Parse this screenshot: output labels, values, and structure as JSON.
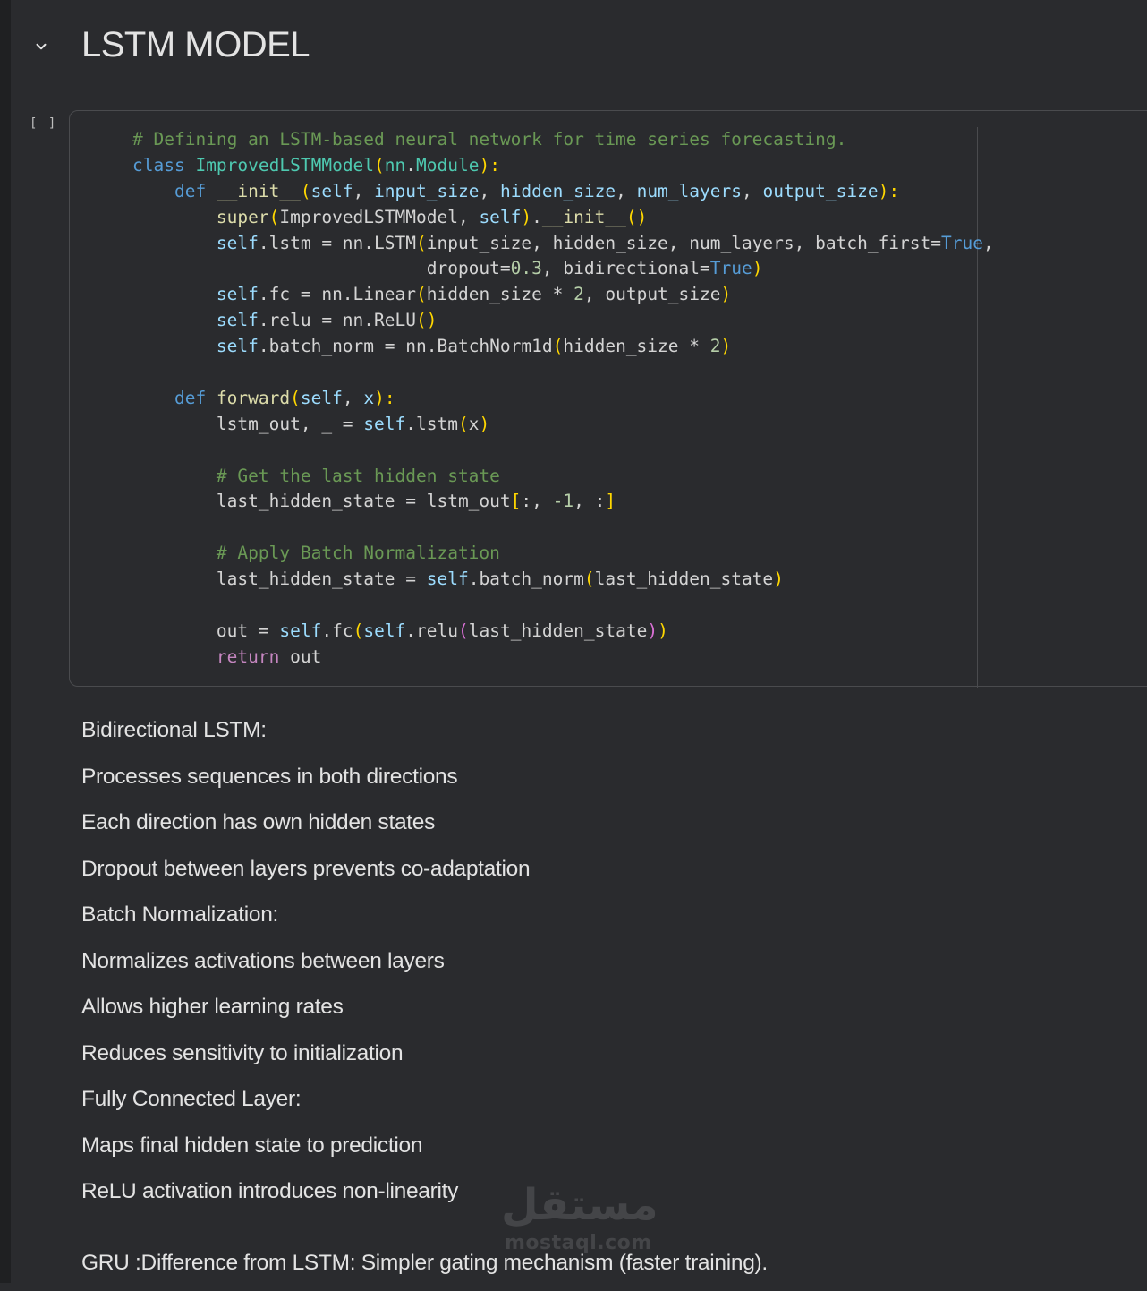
{
  "section": {
    "title": "LSTM MODEL",
    "collapse_icon": "chevron-down-icon"
  },
  "cell": {
    "run_indicator": "[ ]",
    "code_lines": [
      [
        [
          "tk-comment",
          "# Defining an LSTM-based neural network for time series forecasting."
        ]
      ],
      [
        [
          "tk-kw",
          "class "
        ],
        [
          "tk-class",
          "ImprovedLSTMModel"
        ],
        [
          "tk-br1",
          "("
        ],
        [
          "tk-class",
          "nn"
        ],
        [
          "tk-plain",
          "."
        ],
        [
          "tk-class",
          "Module"
        ],
        [
          "tk-br1",
          "):"
        ]
      ],
      [
        [
          "tk-plain",
          "    "
        ],
        [
          "tk-kw",
          "def "
        ],
        [
          "tk-fn",
          "__init__"
        ],
        [
          "tk-br1",
          "("
        ],
        [
          "tk-self",
          "self"
        ],
        [
          "tk-plain",
          ", "
        ],
        [
          "tk-param",
          "input_size"
        ],
        [
          "tk-plain",
          ", "
        ],
        [
          "tk-param",
          "hidden_size"
        ],
        [
          "tk-plain",
          ", "
        ],
        [
          "tk-param",
          "num_layers"
        ],
        [
          "tk-plain",
          ", "
        ],
        [
          "tk-param",
          "output_size"
        ],
        [
          "tk-br1",
          "):"
        ]
      ],
      [
        [
          "tk-plain",
          "        "
        ],
        [
          "tk-fn",
          "super"
        ],
        [
          "tk-br1",
          "("
        ],
        [
          "tk-plain",
          "ImprovedLSTMModel, "
        ],
        [
          "tk-self",
          "self"
        ],
        [
          "tk-br1",
          ")"
        ],
        [
          "tk-plain",
          "."
        ],
        [
          "tk-fn",
          "__init__"
        ],
        [
          "tk-br1",
          "()"
        ]
      ],
      [
        [
          "tk-plain",
          "        "
        ],
        [
          "tk-self",
          "self"
        ],
        [
          "tk-plain",
          ".lstm = nn.LSTM"
        ],
        [
          "tk-br1",
          "("
        ],
        [
          "tk-plain",
          "input_size, hidden_size, num_layers, batch_first="
        ],
        [
          "tk-kw",
          "True"
        ],
        [
          "tk-plain",
          ","
        ]
      ],
      [
        [
          "tk-plain",
          "                            dropout="
        ],
        [
          "tk-num",
          "0.3"
        ],
        [
          "tk-plain",
          ", bidirectional="
        ],
        [
          "tk-kw",
          "True"
        ],
        [
          "tk-br1",
          ")"
        ]
      ],
      [
        [
          "tk-plain",
          "        "
        ],
        [
          "tk-self",
          "self"
        ],
        [
          "tk-plain",
          ".fc = nn.Linear"
        ],
        [
          "tk-br1",
          "("
        ],
        [
          "tk-plain",
          "hidden_size * "
        ],
        [
          "tk-num",
          "2"
        ],
        [
          "tk-plain",
          ", output_size"
        ],
        [
          "tk-br1",
          ")"
        ]
      ],
      [
        [
          "tk-plain",
          "        "
        ],
        [
          "tk-self",
          "self"
        ],
        [
          "tk-plain",
          ".relu = nn.ReLU"
        ],
        [
          "tk-br1",
          "()"
        ]
      ],
      [
        [
          "tk-plain",
          "        "
        ],
        [
          "tk-self",
          "self"
        ],
        [
          "tk-plain",
          ".batch_norm = nn.BatchNorm1d"
        ],
        [
          "tk-br1",
          "("
        ],
        [
          "tk-plain",
          "hidden_size * "
        ],
        [
          "tk-num",
          "2"
        ],
        [
          "tk-br1",
          ")"
        ]
      ],
      [],
      [
        [
          "tk-plain",
          "    "
        ],
        [
          "tk-kw",
          "def "
        ],
        [
          "tk-fn",
          "forward"
        ],
        [
          "tk-br1",
          "("
        ],
        [
          "tk-self",
          "self"
        ],
        [
          "tk-plain",
          ", "
        ],
        [
          "tk-param",
          "x"
        ],
        [
          "tk-br1",
          "):"
        ]
      ],
      [
        [
          "tk-plain",
          "        lstm_out, _ = "
        ],
        [
          "tk-self",
          "self"
        ],
        [
          "tk-plain",
          ".lstm"
        ],
        [
          "tk-br1",
          "("
        ],
        [
          "tk-plain",
          "x"
        ],
        [
          "tk-br1",
          ")"
        ]
      ],
      [],
      [
        [
          "tk-plain",
          "        "
        ],
        [
          "tk-comment",
          "# Get the last hidden state"
        ]
      ],
      [
        [
          "tk-plain",
          "        last_hidden_state = lstm_out"
        ],
        [
          "tk-br1",
          "["
        ],
        [
          "tk-plain",
          ":, "
        ],
        [
          "tk-num",
          "-1"
        ],
        [
          "tk-plain",
          ", :"
        ],
        [
          "tk-br1",
          "]"
        ]
      ],
      [],
      [
        [
          "tk-plain",
          "        "
        ],
        [
          "tk-comment",
          "# Apply Batch Normalization"
        ]
      ],
      [
        [
          "tk-plain",
          "        last_hidden_state = "
        ],
        [
          "tk-self",
          "self"
        ],
        [
          "tk-plain",
          ".batch_norm"
        ],
        [
          "tk-br1",
          "("
        ],
        [
          "tk-plain",
          "last_hidden_state"
        ],
        [
          "tk-br1",
          ")"
        ]
      ],
      [],
      [
        [
          "tk-plain",
          "        out = "
        ],
        [
          "tk-self",
          "self"
        ],
        [
          "tk-plain",
          ".fc"
        ],
        [
          "tk-br1",
          "("
        ],
        [
          "tk-self",
          "self"
        ],
        [
          "tk-plain",
          ".relu"
        ],
        [
          "tk-br2",
          "("
        ],
        [
          "tk-plain",
          "last_hidden_state"
        ],
        [
          "tk-br2",
          ")"
        ],
        [
          "tk-br1",
          ")"
        ]
      ],
      [
        [
          "tk-plain",
          "        "
        ],
        [
          "tk-ctrl",
          "return"
        ],
        [
          "tk-plain",
          " out"
        ]
      ]
    ]
  },
  "notes": [
    "Bidirectional LSTM:",
    "Processes sequences in both directions",
    "Each direction has own hidden states",
    "Dropout between layers prevents co-adaptation",
    "Batch Normalization:",
    "Normalizes activations between layers",
    "Allows higher learning rates",
    "Reduces sensitivity to initialization",
    "Fully Connected Layer:",
    "Maps final hidden state to prediction",
    "ReLU activation introduces non-linearity",
    "GRU :Difference from LSTM: Simpler gating mechanism (faster training)."
  ],
  "watermark": {
    "arabic": "مستقل",
    "latin": "mostaql.com"
  }
}
